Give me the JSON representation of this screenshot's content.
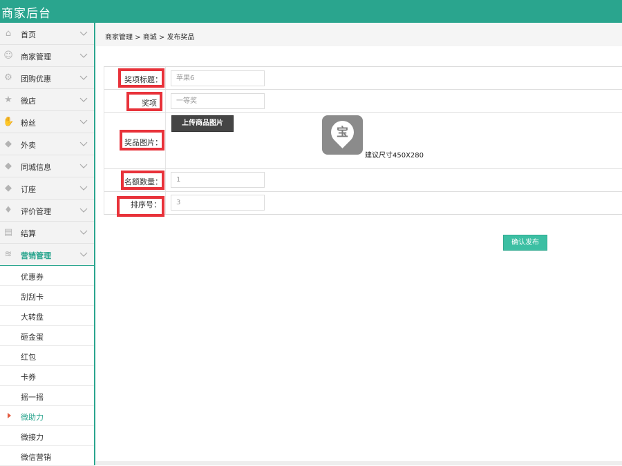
{
  "header": {
    "title": "商家后台"
  },
  "sidebar": {
    "items": [
      {
        "label": "首页",
        "icon": "home-icon",
        "glyph": "⌂"
      },
      {
        "label": "商家管理",
        "icon": "user-icon",
        "glyph": "☺"
      },
      {
        "label": "团购优惠",
        "icon": "gear-icon",
        "glyph": "⚙"
      },
      {
        "label": "微店",
        "icon": "star-icon",
        "glyph": "★"
      },
      {
        "label": "粉丝",
        "icon": "hand-icon",
        "glyph": "✋"
      },
      {
        "label": "外卖",
        "icon": "tag-icon",
        "glyph": "◆"
      },
      {
        "label": "同城信息",
        "icon": "tag-icon",
        "glyph": "◆"
      },
      {
        "label": "订座",
        "icon": "tag-icon",
        "glyph": "◆"
      },
      {
        "label": "评价管理",
        "icon": "tie-icon",
        "glyph": "♦"
      },
      {
        "label": "结算",
        "icon": "chart-icon",
        "glyph": "▤"
      },
      {
        "label": "营销管理",
        "icon": "layers-icon",
        "glyph": "≋"
      }
    ],
    "submenu": [
      {
        "label": "优惠券"
      },
      {
        "label": "刮刮卡"
      },
      {
        "label": "大转盘"
      },
      {
        "label": "砸金蛋"
      },
      {
        "label": "红包"
      },
      {
        "label": "卡券"
      },
      {
        "label": "摇一摇"
      },
      {
        "label": "微助力"
      },
      {
        "label": "微接力"
      },
      {
        "label": "微信营销"
      }
    ]
  },
  "breadcrumb": {
    "text": "商家管理 > 商城 > 发布奖品"
  },
  "form": {
    "title_label": "奖项标题：",
    "title_placeholder": "苹果6",
    "prize_label": "奖项",
    "prize_placeholder": "一等奖",
    "image_label": "奖品图片：",
    "upload_label": "上传商品图片",
    "thumb_glyph": "宝",
    "size_hint": "建议尺寸450X280",
    "quota_label": "名额数量：",
    "quota_placeholder": "1",
    "sort_label": "排序号：",
    "sort_placeholder": "3"
  },
  "actions": {
    "submit_label": "确认发布"
  },
  "colors": {
    "accent": "#2aa58e",
    "highlight": "#e8323a",
    "button": "#3cbfa3"
  }
}
